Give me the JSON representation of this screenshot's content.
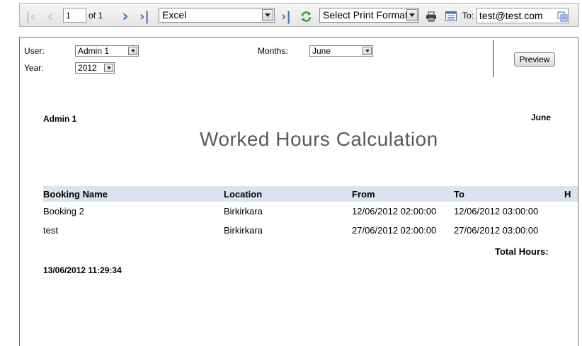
{
  "toolbar": {
    "page_number": "1",
    "page_of": "of 1",
    "export_format": "Excel",
    "print_format": "Select Print Format",
    "to_label": "To:",
    "email": "test@test.com",
    "icons": {
      "first": "first-page-icon",
      "prev": "previous-page-icon",
      "next": "next-page-icon",
      "last": "last-page-icon",
      "export": "export-icon",
      "refresh": "refresh-icon",
      "print": "print-icon",
      "layout": "page-layout-icon",
      "send": "send-email-icon"
    },
    "colors": {
      "nav_active": "#3d6fb4",
      "nav_disabled": "#c4c4c4",
      "refresh": "#3a9a3a"
    }
  },
  "params": {
    "user_label": "User:",
    "user_value": "Admin 1",
    "year_label": "Year:",
    "year_value": "2012",
    "months_label": "Months:",
    "months_value": "June",
    "preview_label": "Preview"
  },
  "report": {
    "user": "Admin 1",
    "month": "June",
    "title": "Worked Hours Calculation",
    "columns": [
      "Booking Name",
      "Location",
      "From",
      "To",
      "H"
    ],
    "rows": [
      [
        "Booking 2",
        "Birkirkara",
        "12/06/2012 02:00:00",
        "12/06/2012 03:00:00"
      ],
      [
        "test",
        "Birkirkara",
        "27/06/2012 02:00:00",
        "27/06/2012 03:00:00"
      ]
    ],
    "total_label": "Total Hours:",
    "timestamp": "13/06/2012 11:29:34",
    "header_bg": "#dde3ee"
  }
}
